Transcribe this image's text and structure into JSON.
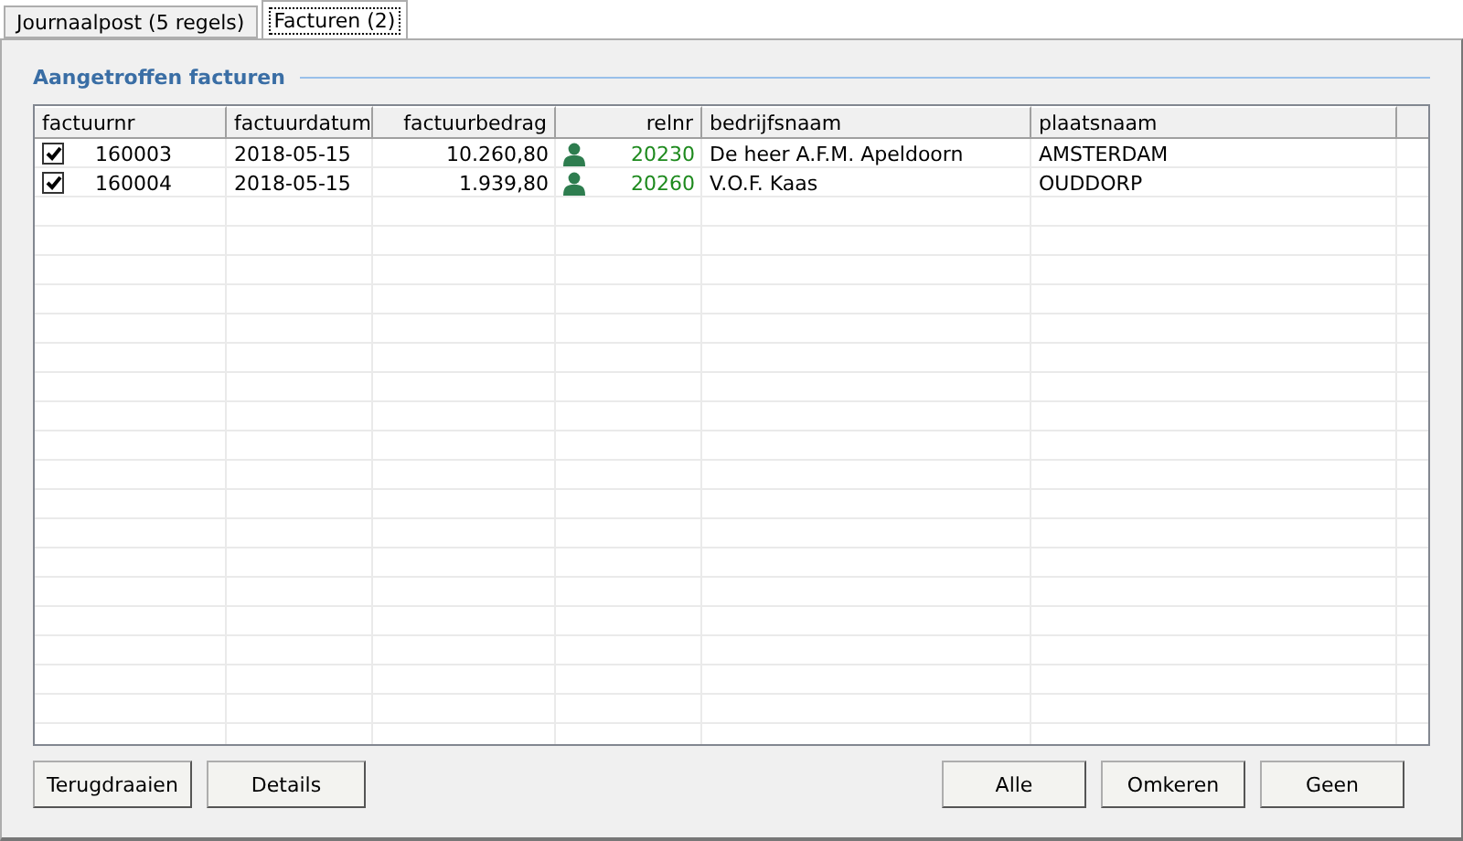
{
  "tabs": [
    {
      "label": "Journaalpost (5 regels)",
      "selected": false
    },
    {
      "label": "Facturen (2)",
      "selected": true
    }
  ],
  "section_title": "Aangetroffen facturen",
  "table": {
    "columns": [
      "factuurnr",
      "factuurdatum",
      "factuurbedrag",
      "relnr",
      "bedrijfsnaam",
      "plaatsnaam"
    ],
    "rows": [
      {
        "checked": true,
        "factuurnr": "160003",
        "factuurdatum": "2018-05-15",
        "factuurbedrag": "10.260,80",
        "relnr": "20230",
        "bedrijfsnaam": "De heer A.F.M. Apeldoorn",
        "plaatsnaam": "AMSTERDAM"
      },
      {
        "checked": true,
        "factuurnr": "160004",
        "factuurdatum": "2018-05-15",
        "factuurbedrag": "1.939,80",
        "relnr": "20260",
        "bedrijfsnaam": "V.O.F. Kaas",
        "plaatsnaam": "OUDDORP"
      }
    ]
  },
  "left_buttons": [
    "Terugdraaien",
    "Details"
  ],
  "right_buttons": [
    "Alle",
    "Omkeren",
    "Geen"
  ]
}
